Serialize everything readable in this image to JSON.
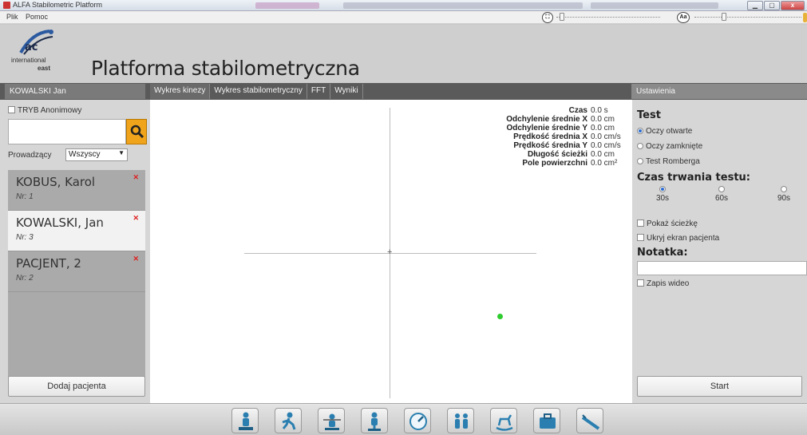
{
  "window": {
    "title": "ALFA Stabilometric Platform",
    "min_label": "▁",
    "max_label": "▢",
    "close_label": "x"
  },
  "menu": {
    "items": [
      "Plik",
      "Pomoc"
    ],
    "font_icon_label": "Aa"
  },
  "header": {
    "logo_ac": "ac",
    "logo_international": "international",
    "logo_east": "east",
    "title": "Platforma stabilometryczna"
  },
  "patient_header": "KOWALSKI Jan",
  "tabs": [
    {
      "label": "Wykres kinezy"
    },
    {
      "label": "Wykres stabilometryczny"
    },
    {
      "label": "FFT"
    },
    {
      "label": "Wyniki"
    }
  ],
  "settings_header": "Ustawienia",
  "left": {
    "anon_label": "TRYB Anonimowy",
    "lead_label": "Prowadzący",
    "lead_value": "Wszyscy",
    "patients": [
      {
        "name": "KOBUS, Karol",
        "nr": "Nr: 1",
        "selected": false
      },
      {
        "name": "KOWALSKI, Jan",
        "nr": "Nr: 3",
        "selected": true
      },
      {
        "name": "PACJENT, 2",
        "nr": "Nr: 2",
        "selected": false
      }
    ],
    "add_button": "Dodaj pacjenta"
  },
  "stats": [
    {
      "label": "Czas",
      "value": "0.0 s"
    },
    {
      "label": "Odchylenie średnie X",
      "value": "0.0 cm"
    },
    {
      "label": "Odchylenie średnie Y",
      "value": "0.0 cm"
    },
    {
      "label": "Prędkość średnia X",
      "value": "0.0 cm/s"
    },
    {
      "label": "Prędkość średnia Y",
      "value": "0.0 cm/s"
    },
    {
      "label": "Długość ścieżki",
      "value": "0.0 cm"
    },
    {
      "label": "Pole powierzchni",
      "value": "0.0 cm²"
    }
  ],
  "right": {
    "test_title": "Test",
    "test_options": [
      {
        "label": "Oczy otwarte",
        "selected": true
      },
      {
        "label": "Oczy zamknięte",
        "selected": false
      },
      {
        "label": "Test Romberga",
        "selected": false
      }
    ],
    "duration_title": "Czas trwania testu:",
    "durations": [
      {
        "label": "30s",
        "selected": true
      },
      {
        "label": "60s",
        "selected": false
      },
      {
        "label": "90s",
        "selected": false
      }
    ],
    "show_path": "Pokaż ścieżkę",
    "hide_screen": "Ukryj ekran pacjenta",
    "note_title": "Notatka:",
    "video": "Zapis wideo",
    "start_button": "Start"
  },
  "toolbar_icons": [
    "standing-person-icon",
    "walking-person-icon",
    "balance-beam-icon",
    "single-leg-person-icon",
    "gauge-icon",
    "two-persons-icon",
    "rocking-horse-icon",
    "briefcase-icon",
    "ramp-icon"
  ],
  "colors": {
    "accent_search": "#f0a41c",
    "point": "#2ecc2e",
    "delete": "#dd2222",
    "strip": "#5a5a5a",
    "radio_selected": "#2b6cd1"
  }
}
